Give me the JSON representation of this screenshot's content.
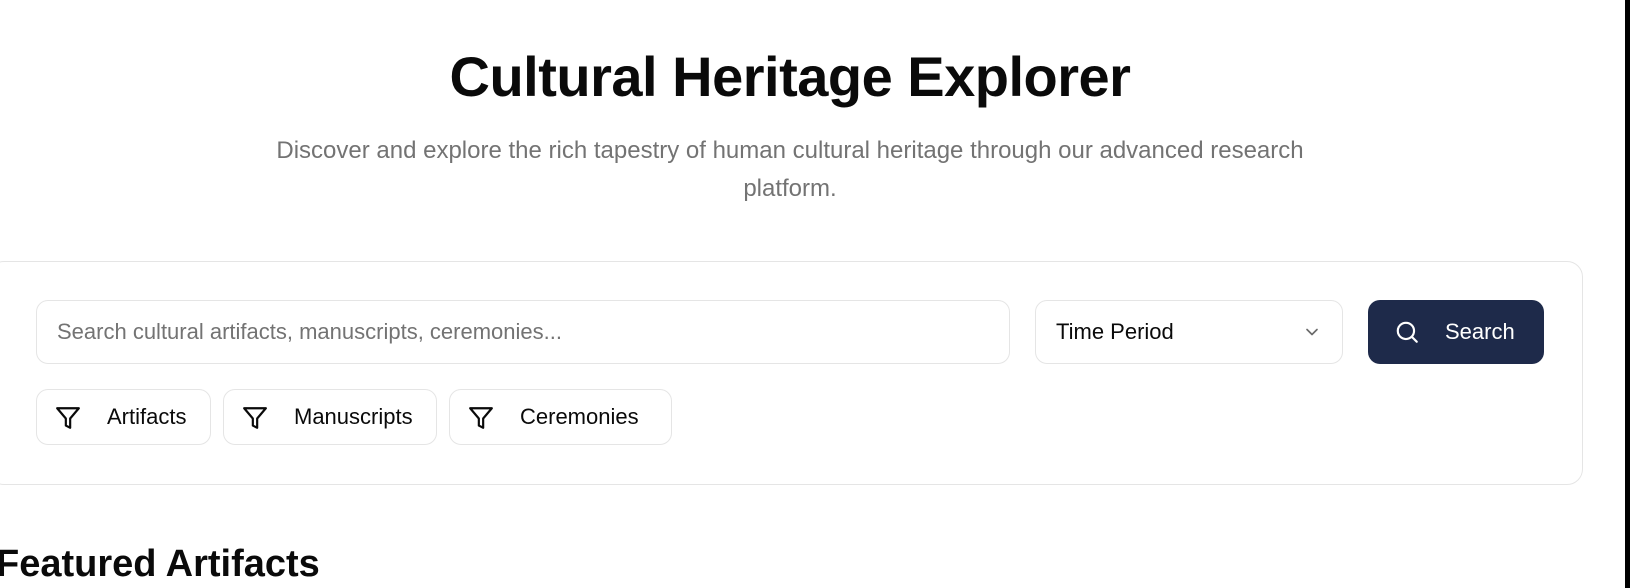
{
  "hero": {
    "title": "Cultural Heritage Explorer",
    "subtitle": "Discover and explore the rich tapestry of human cultural heritage through our advanced research platform."
  },
  "search": {
    "placeholder": "Search cultural artifacts, manuscripts, ceremonies...",
    "value": "",
    "time_period_label": "Time Period",
    "button_label": "Search",
    "button_color": "#1e2a4a"
  },
  "filters": [
    {
      "label": "Artifacts",
      "icon": "filter-icon"
    },
    {
      "label": "Manuscripts",
      "icon": "filter-icon"
    },
    {
      "label": "Ceremonies",
      "icon": "filter-icon"
    }
  ],
  "featured": {
    "title": "Featured Artifacts"
  }
}
